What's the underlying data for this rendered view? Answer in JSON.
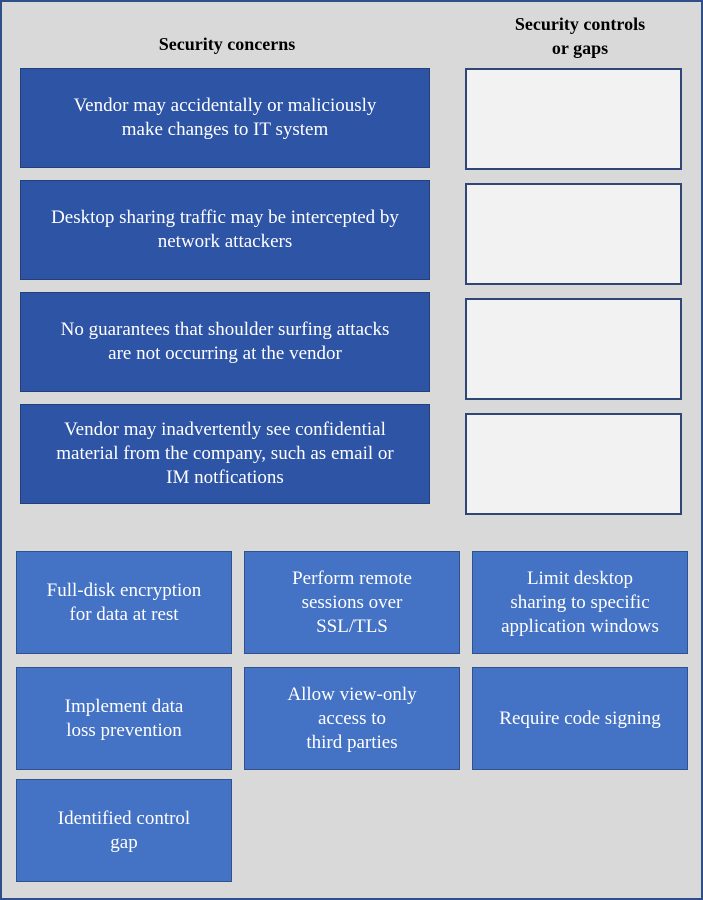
{
  "headers": {
    "concerns": "Security concerns",
    "controls": "Security controls\nor gaps"
  },
  "concerns": [
    {
      "label": "Vendor may accidentally or maliciously\nmake changes to IT system"
    },
    {
      "label": "Desktop sharing traffic may be intercepted by\nnetwork attackers"
    },
    {
      "label": "No guarantees that shoulder surfing attacks\nare not occurring at the vendor"
    },
    {
      "label": "Vendor may inadvertently see confidential\nmaterial from the company, such as email or\nIM notfications"
    }
  ],
  "drop_slots": [
    {
      "value": ""
    },
    {
      "value": ""
    },
    {
      "value": ""
    },
    {
      "value": ""
    }
  ],
  "options": [
    {
      "label": "Full-disk encryption\nfor data at rest"
    },
    {
      "label": "Perform remote\nsessions over\nSSL/TLS"
    },
    {
      "label": "Limit desktop\nsharing to specific\napplication windows"
    },
    {
      "label": "Implement data\nloss prevention"
    },
    {
      "label": "Allow view-only\naccess to\nthird parties"
    },
    {
      "label": "Require code signing"
    },
    {
      "label": "Identified control\ngap"
    }
  ],
  "colors": {
    "background": "#d9d9d9",
    "concern_fill": "#2e54a6",
    "option_fill": "#4472c4",
    "slot_fill": "#f2f2f2",
    "border": "#2f4f8a"
  }
}
